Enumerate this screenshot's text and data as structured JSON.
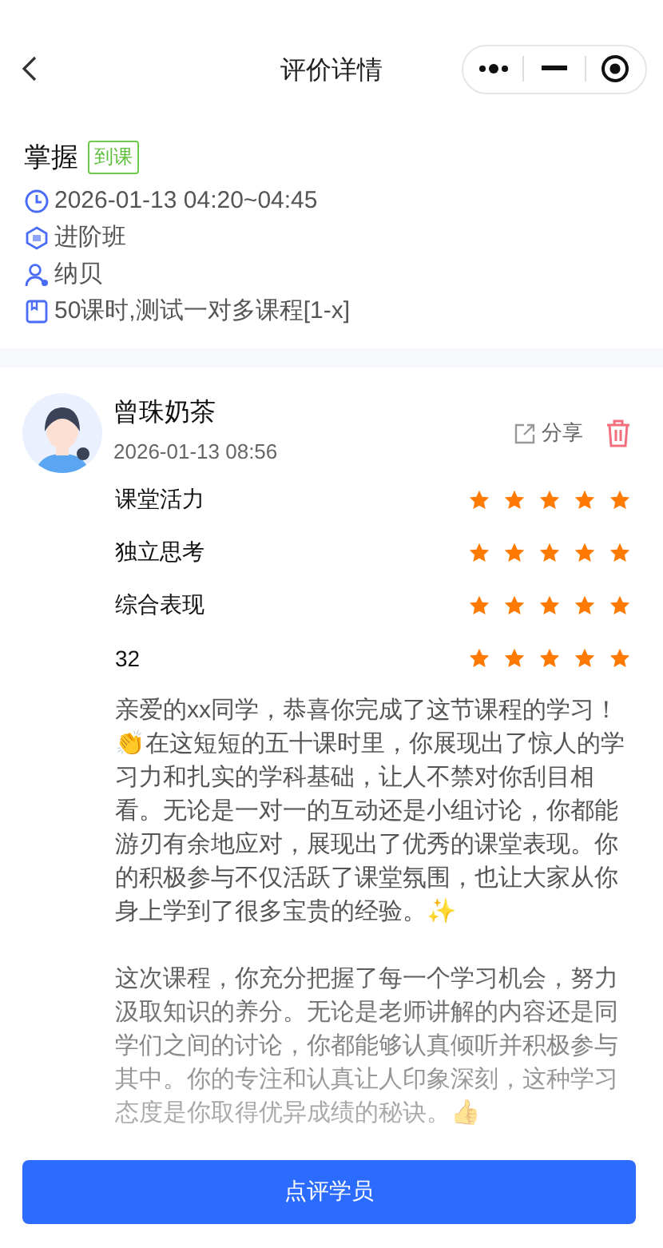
{
  "header": {
    "title": "评价详情"
  },
  "lesson": {
    "title": "掌握",
    "tag": "到课",
    "time": "2026-01-13 04:20~04:45",
    "class_name": "进阶班",
    "teacher": "纳贝",
    "course": "50课时,测试一对多课程[1-x]"
  },
  "review": {
    "student": "曾珠奶茶",
    "date": "2026-01-13 08:56",
    "share": "分享",
    "ratings": [
      {
        "label": "课堂活力",
        "stars": 5
      },
      {
        "label": "独立思考",
        "stars": 5
      },
      {
        "label": "综合表现",
        "stars": 5
      },
      {
        "label": "32",
        "stars": 5
      }
    ],
    "comment": "亲爱的xx同学，恭喜你完成了这节课程的学习！👏在这短短的五十课时里，你展现出了惊人的学习力和扎实的学科基础，让人不禁对你刮目相看。无论是一对一的互动还是小组讨论，你都能游刃有余地应对，展现出了优秀的课堂表现。你的积极参与不仅活跃了课堂氛围，也让大家从你身上学到了很多宝贵的经验。✨\n\n这次课程，你充分把握了每一个学习机会，努力汲取知识的养分。无论是老师讲解的内容还是同学们之间的讨论，你都能够认真倾听并积极参与其中。你的专注和认真让人印象深刻，这种学习态度是你取得优异成绩的秘诀。👍"
  },
  "footer": {
    "button": "点评学员"
  }
}
